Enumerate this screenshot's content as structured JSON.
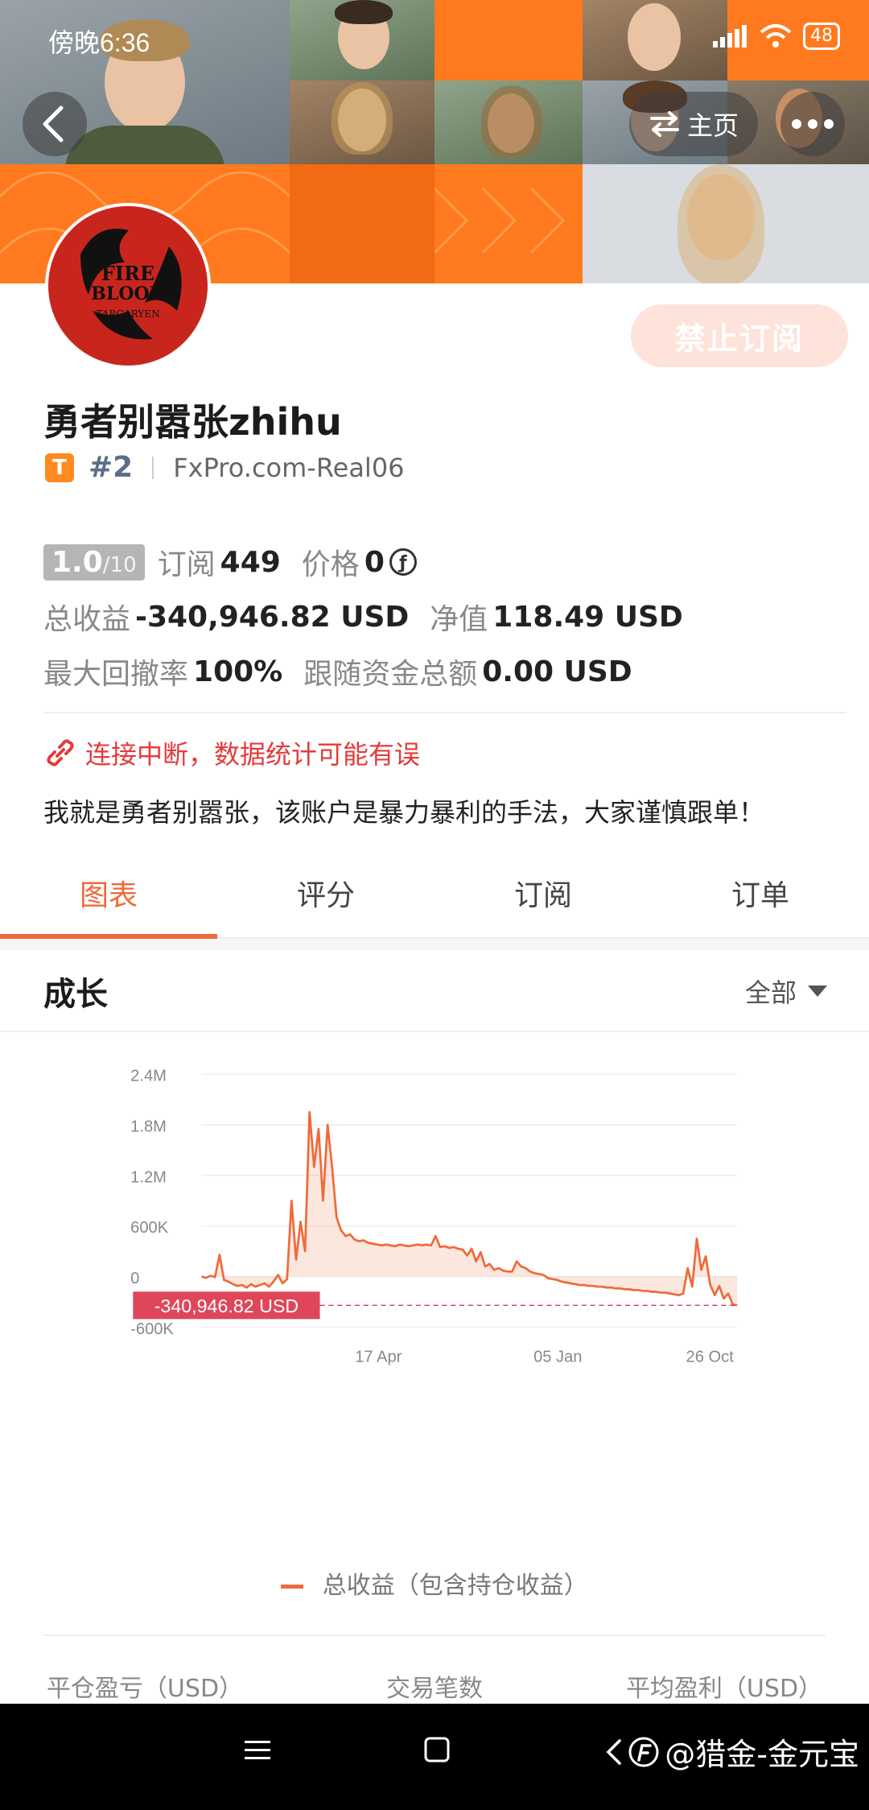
{
  "status_bar": {
    "time": "傍晚6:36",
    "signal": "4G",
    "battery": "48"
  },
  "header": {
    "home_label": "主页"
  },
  "profile": {
    "name": "勇者别嚣张zhihu",
    "badge": "T",
    "rank": "#2",
    "account": "FxPro.com-Real06",
    "subscribe_label": "禁止订阅"
  },
  "stats": {
    "score": "1.0",
    "score_max": "/10",
    "subscribe_label": "订阅",
    "subscribe_count": "449",
    "price_label": "价格",
    "price_value": "0",
    "price_coin": "ƒ",
    "total_profit_label": "总收益",
    "total_profit_value": "-340,946.82 USD",
    "net_value_label": "净值",
    "net_value_value": "118.49 USD",
    "drawdown_label": "最大回撤率",
    "drawdown_value": "100%",
    "follow_label": "跟随资金总额",
    "follow_value": "0.00 USD"
  },
  "warning": "连接中断，数据统计可能有误",
  "description": "我就是勇者别嚣张，该账户是暴力暴利的手法，大家谨慎跟单！",
  "tabs": [
    "图表",
    "评分",
    "订阅",
    "订单"
  ],
  "section": {
    "title": "成长",
    "range": "全部"
  },
  "chart_data": {
    "type": "area",
    "series": [
      {
        "name": "总收益（包含持仓收益）",
        "color": "#ef6a3a"
      }
    ],
    "y_ticks": [
      "2.4M",
      "1.8M",
      "1.2M",
      "600K",
      "0",
      "-600K"
    ],
    "ylim": [
      -600000,
      2400000
    ],
    "x_ticks": [
      "17 Apr",
      "05 Jan",
      "26 Oct"
    ],
    "current_label": "-340,946.82 USD",
    "current_value": -340946.82,
    "values": [
      0,
      -15000,
      10000,
      -5000,
      260000,
      -40000,
      -60000,
      -90000,
      -110000,
      -100000,
      -130000,
      -90000,
      -120000,
      -100000,
      -80000,
      -120000,
      -60000,
      20000,
      -80000,
      -30000,
      900000,
      200000,
      650000,
      300000,
      1950000,
      1300000,
      1750000,
      900000,
      1800000,
      1300000,
      700000,
      550000,
      480000,
      500000,
      440000,
      420000,
      430000,
      400000,
      390000,
      380000,
      370000,
      380000,
      370000,
      360000,
      380000,
      370000,
      360000,
      370000,
      380000,
      370000,
      380000,
      370000,
      480000,
      350000,
      360000,
      340000,
      350000,
      330000,
      320000,
      250000,
      330000,
      180000,
      290000,
      120000,
      150000,
      80000,
      100000,
      70000,
      60000,
      60000,
      180000,
      120000,
      100000,
      60000,
      40000,
      30000,
      20000,
      -20000,
      -30000,
      -40000,
      -60000,
      -70000,
      -80000,
      -90000,
      -100000,
      -100000,
      -110000,
      -110000,
      -120000,
      -120000,
      -130000,
      -130000,
      -140000,
      -140000,
      -150000,
      -150000,
      -160000,
      -160000,
      -170000,
      -170000,
      -180000,
      -180000,
      -190000,
      -190000,
      -200000,
      -210000,
      -220000,
      -200000,
      100000,
      -120000,
      450000,
      80000,
      240000,
      -100000,
      -220000,
      -110000,
      -260000,
      -200000,
      -330000,
      -340946.82
    ]
  },
  "legend_label": "总收益（包含持仓收益）",
  "footer": [
    "平仓盈亏（USD）",
    "交易笔数",
    "平均盈利（USD）"
  ],
  "navbar": {
    "watermark": "@猎金-金元宝"
  }
}
